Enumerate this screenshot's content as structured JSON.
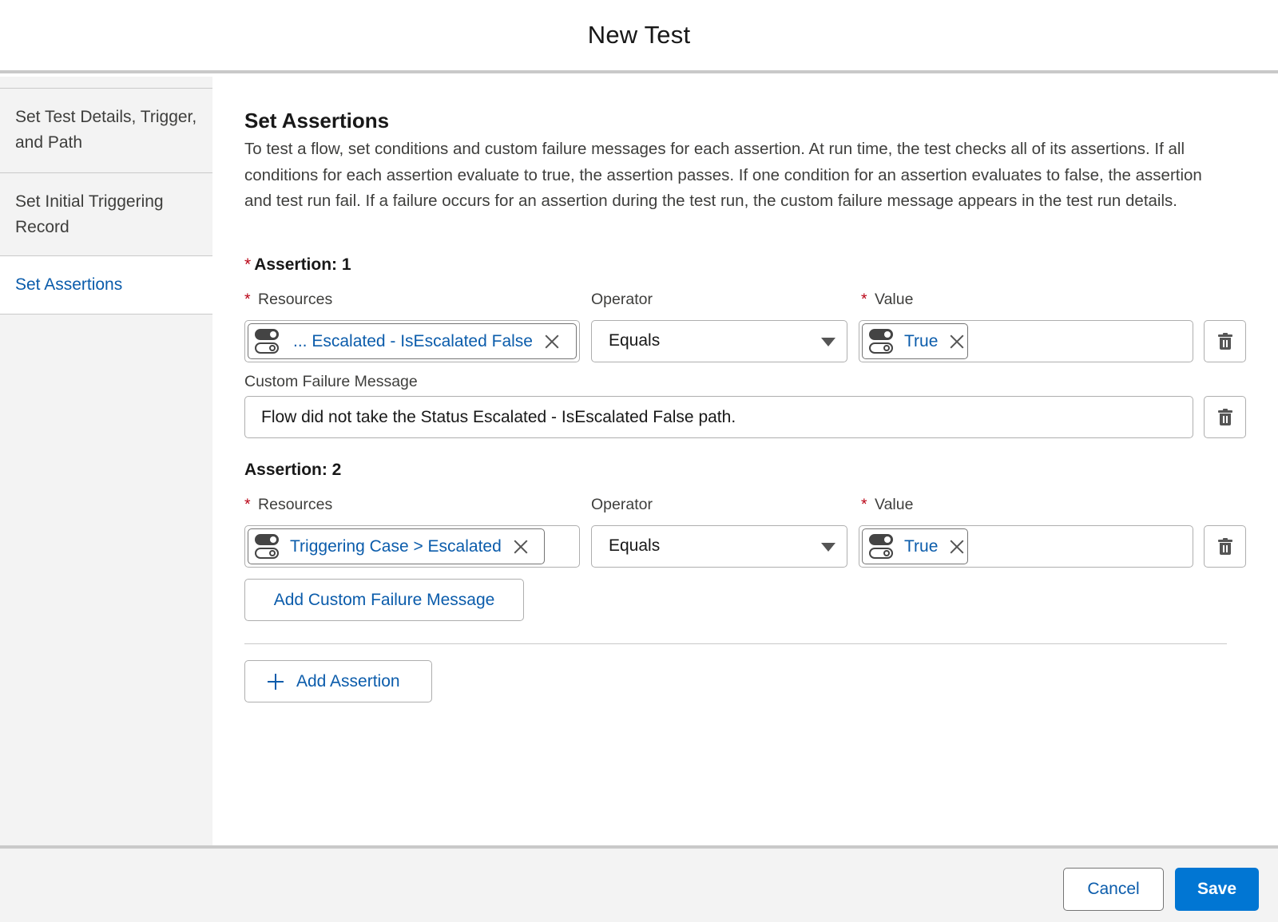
{
  "modal": {
    "title": "New Test"
  },
  "sidebar": {
    "items": [
      {
        "label": "Set Test Details, Trigger, and Path"
      },
      {
        "label": "Set Initial Triggering Record"
      },
      {
        "label": "Set Assertions",
        "active": true
      }
    ]
  },
  "section": {
    "title": "Set Assertions",
    "description": "To test a flow, set conditions and custom failure messages for each assertion. At run time, the test checks all of its assertions. If all conditions for each assertion evaluate to true, the assertion passes. If one condition for an assertion evaluates to false, the assertion and test run fail. If a failure occurs for an assertion during the test run, the custom failure message appears in the test run details."
  },
  "labels": {
    "resources": "Resources",
    "operator": "Operator",
    "value": "Value",
    "custom_failure_message": "Custom Failure Message",
    "required_marker": "*"
  },
  "assertions": [
    {
      "heading": "Assertion: 1",
      "required": true,
      "resource_pill": "... Escalated - IsEscalated False",
      "operator": "Equals",
      "value_pill": "True",
      "custom_failure_message": "Flow did not take the Status Escalated - IsEscalated False path."
    },
    {
      "heading": "Assertion: 2",
      "required": false,
      "resource_pill": "Triggering Case > Escalated",
      "operator": "Equals",
      "value_pill": "True",
      "add_message_button": "Add Custom Failure Message"
    }
  ],
  "add_assertion_button": "Add Assertion",
  "footer": {
    "cancel": "Cancel",
    "save": "Save"
  },
  "colors": {
    "brand": "#0176d3",
    "link": "#0b5cab",
    "required": "#ba0517",
    "panel": "#f3f3f3"
  },
  "icons": [
    "toggle-icon",
    "close-icon",
    "chevron-down-icon",
    "delete-icon",
    "add-icon"
  ]
}
